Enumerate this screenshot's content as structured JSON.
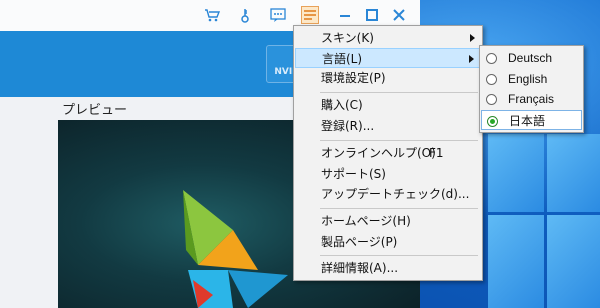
{
  "titlebar": {
    "icons": [
      "cart-icon",
      "key-icon",
      "chat-icon",
      "menu-icon",
      "minimize-icon",
      "maximize-icon",
      "close-icon"
    ]
  },
  "header": {
    "badge_text": "NVID"
  },
  "preview": {
    "label": "プレビュー"
  },
  "menu": {
    "items": [
      {
        "label": "スキン(K)",
        "has_submenu": true
      },
      {
        "label": "言語(L)",
        "has_submenu": true,
        "highlighted": true
      },
      {
        "label": "環境設定(P)"
      },
      {
        "label": "購入(C)"
      },
      {
        "label": "登録(R)..."
      },
      {
        "label": "オンラインヘルプ(O)",
        "shortcut": "F1"
      },
      {
        "label": "サポート(S)"
      },
      {
        "label": "アップデートチェック(d)..."
      },
      {
        "label": "ホームページ(H)"
      },
      {
        "label": "製品ページ(P)"
      },
      {
        "label": "詳細情報(A)..."
      }
    ]
  },
  "language_submenu": {
    "options": [
      "Deutsch",
      "English",
      "Français",
      "日本語"
    ],
    "selected": "日本語"
  },
  "colors": {
    "accent": "#1e89d6",
    "highlight": "#cce8ff",
    "radio_selected": "#27a827"
  }
}
